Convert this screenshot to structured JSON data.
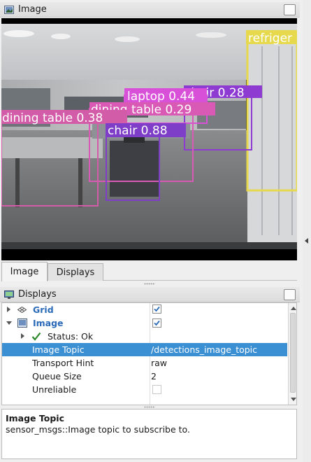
{
  "image_panel": {
    "title": "Image",
    "icon": "image-icon",
    "detections": [
      {
        "label": "refriger",
        "color": "#e6d94e"
      },
      {
        "label": "laptop 0.44",
        "color": "#d84fd8"
      },
      {
        "label": "chair 0.28",
        "color": "#8d3bd1"
      },
      {
        "label": "dining table 0.29",
        "color": "#d95ab5"
      },
      {
        "label": "dining table 0.38",
        "color": "#d35ca8"
      },
      {
        "label": "chair 0.88",
        "color": "#7f3ec8"
      }
    ]
  },
  "tabs": [
    {
      "label": "Image",
      "active": true
    },
    {
      "label": "Displays",
      "active": false
    }
  ],
  "displays_panel": {
    "title": "Displays",
    "icon": "monitor-icon",
    "rows": {
      "grid": {
        "label": "Grid",
        "icon": "grid-icon",
        "checked": true
      },
      "image": {
        "label": "Image",
        "icon": "image-icon",
        "checked": true
      },
      "status": {
        "label": "Status: Ok",
        "icon": "checkmark-icon"
      },
      "image_topic": {
        "label": "Image Topic",
        "value": "/detections_image_topic"
      },
      "transport_hint": {
        "label": "Transport Hint",
        "value": "raw"
      },
      "queue_size": {
        "label": "Queue Size",
        "value": "2"
      },
      "unreliable": {
        "label": "Unreliable",
        "checked": false
      }
    }
  },
  "help": {
    "title": "Image Topic",
    "text": "sensor_msgs::Image topic to subscribe to."
  },
  "colors": {
    "selection": "#3b8fd3",
    "link_blue": "#2a6ab8",
    "check_green": "#2a8a2a"
  }
}
